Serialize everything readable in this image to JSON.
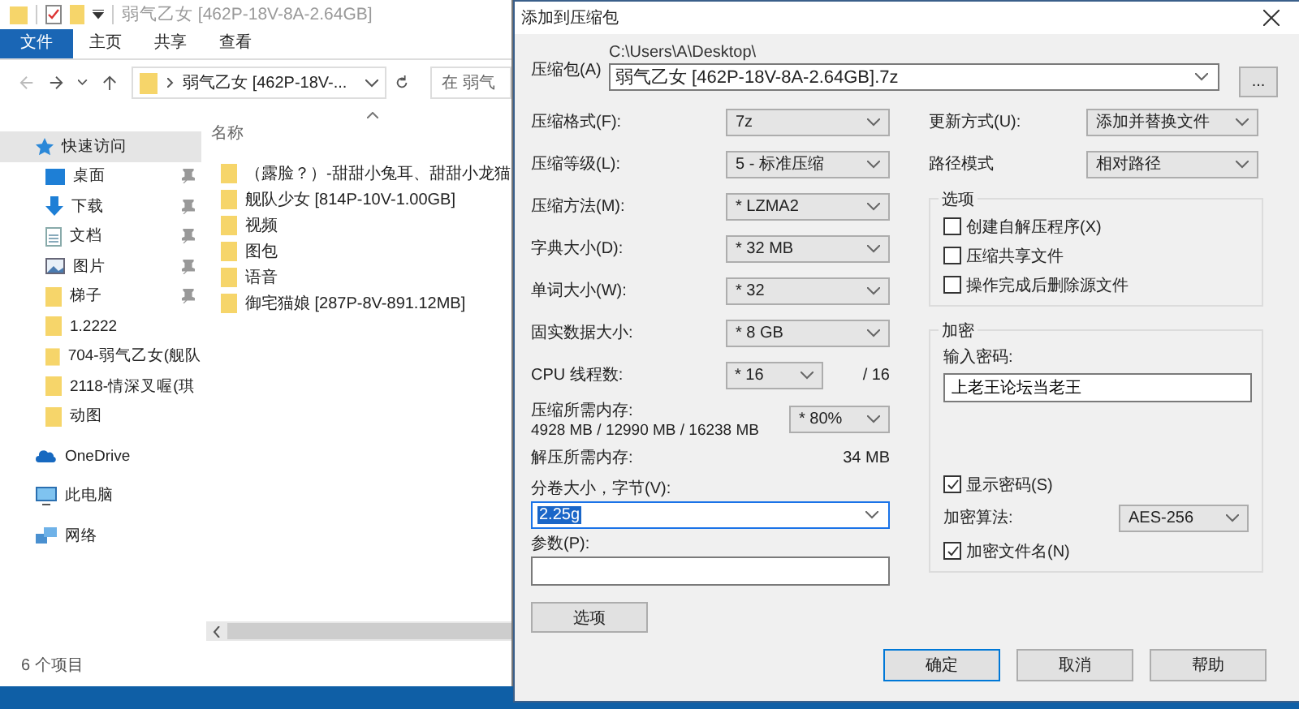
{
  "explorer": {
    "title": "弱气乙女 [462P-18V-8A-2.64GB]",
    "ribbon_tabs": [
      {
        "label": "文件",
        "selected": true
      },
      {
        "label": "主页",
        "selected": false
      },
      {
        "label": "共享",
        "selected": false
      },
      {
        "label": "查看",
        "selected": false
      }
    ],
    "address": "弱气乙女 [462P-18V-...",
    "search": {
      "placeholder": "在 弱气"
    },
    "nav": [
      {
        "label": "快速访问",
        "kind": "quick",
        "selected": true,
        "pinned": false
      },
      {
        "label": "桌面",
        "kind": "desktop",
        "selected": false,
        "pinned": true
      },
      {
        "label": "下载",
        "kind": "download",
        "selected": false,
        "pinned": true
      },
      {
        "label": "文档",
        "kind": "document",
        "selected": false,
        "pinned": true
      },
      {
        "label": "图片",
        "kind": "pictures",
        "selected": false,
        "pinned": true
      },
      {
        "label": "梯子",
        "kind": "folder",
        "selected": false,
        "pinned": true
      },
      {
        "label": "1.2222",
        "kind": "folder",
        "selected": false,
        "pinned": false
      },
      {
        "label": "704-弱气乙女(舰队",
        "kind": "folder",
        "selected": false,
        "pinned": false
      },
      {
        "label": "2118-情深叉喔(琪",
        "kind": "folder",
        "selected": false,
        "pinned": false
      },
      {
        "label": "动图",
        "kind": "folder",
        "selected": false,
        "pinned": false
      },
      {
        "label": "OneDrive",
        "kind": "onedrive",
        "selected": false,
        "pinned": false
      },
      {
        "label": "此电脑",
        "kind": "pc",
        "selected": false,
        "pinned": false
      },
      {
        "label": "网络",
        "kind": "network",
        "selected": false,
        "pinned": false
      }
    ],
    "column_header": "名称",
    "files": [
      {
        "name": "（露脸？）-甜甜小兔耳、甜甜小龙猫"
      },
      {
        "name": "舰队少女 [814P-10V-1.00GB]"
      },
      {
        "name": "视频"
      },
      {
        "name": "图包"
      },
      {
        "name": "语音"
      },
      {
        "name": "御宅猫娘 [287P-8V-891.12MB]"
      }
    ],
    "status": "6 个项目"
  },
  "dialog": {
    "title": "添加到压缩包",
    "archive": {
      "label": "压缩包(A)",
      "path": "C:\\Users\\A\\Desktop\\",
      "value": "弱气乙女 [462P-18V-8A-2.64GB].7z",
      "browse": "..."
    },
    "settings": [
      {
        "label": "压缩格式(F):",
        "value": "7z"
      },
      {
        "label": "压缩等级(L):",
        "value": "5 - 标准压缩"
      },
      {
        "label": "压缩方法(M):",
        "value": "* LZMA2"
      },
      {
        "label": "字典大小(D):",
        "value": "* 32 MB"
      },
      {
        "label": "单词大小(W):",
        "value": "* 32"
      },
      {
        "label": "固实数据大小:",
        "value": "* 8 GB"
      }
    ],
    "threads": {
      "label": "CPU 线程数:",
      "value": "* 16",
      "max": "/ 16"
    },
    "memory": {
      "label": "压缩所需内存:",
      "detail": "4928 MB / 12990 MB / 16238 MB",
      "value": "* 80%"
    },
    "decompress_memory": {
      "label": "解压所需内存:",
      "value": "34 MB"
    },
    "volume": {
      "label": "分卷大小，字节(V):",
      "value": "2.25g"
    },
    "parameters": {
      "label": "参数(P):"
    },
    "options_button": "选项",
    "update": {
      "label": "更新方式(U):",
      "value": "添加并替换文件"
    },
    "path_mode": {
      "label": "路径模式",
      "value": "相对路径"
    },
    "options": {
      "title": "选项",
      "items": [
        {
          "label": "创建自解压程序(X)",
          "checked": false
        },
        {
          "label": "压缩共享文件",
          "checked": false
        },
        {
          "label": "操作完成后删除源文件",
          "checked": false
        }
      ]
    },
    "encryption": {
      "title": "加密",
      "password_label": "输入密码:",
      "password": "上老王论坛当老王",
      "show_password": {
        "label": "显示密码(S)",
        "checked": true
      },
      "method": {
        "label": "加密算法:",
        "value": "AES-256"
      },
      "encrypt_names": {
        "label": "加密文件名(N)",
        "checked": true
      }
    },
    "buttons": [
      {
        "label": "确定",
        "kind": "default"
      },
      {
        "label": "取消",
        "kind": "normal"
      },
      {
        "label": "帮助",
        "kind": "normal"
      }
    ]
  }
}
